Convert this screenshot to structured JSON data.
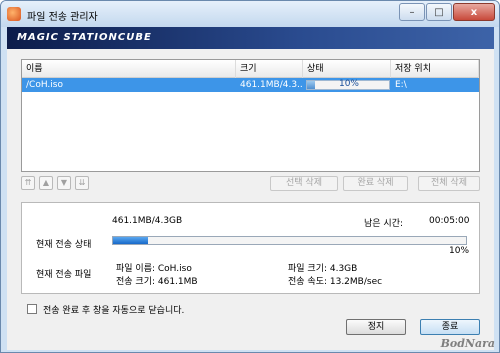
{
  "window": {
    "title": "파일 전송 관리자",
    "logo": "MAGIC STATIONCUBE",
    "minimize": "–",
    "maximize": "□",
    "close": "x"
  },
  "list": {
    "columns": [
      "이름",
      "크기",
      "상태",
      "저장 위치"
    ],
    "rows": [
      {
        "name": "/CoH.iso",
        "size": "461.1MB/4.3...",
        "status_percent": 10,
        "status_text": "10%",
        "location": "E:\\"
      }
    ]
  },
  "toolbar": {
    "move_top": "⇈",
    "move_up": "▲",
    "move_down": "▼",
    "move_bottom": "⇊",
    "delete_selected": "선택 삭제",
    "delete_completed": "완료 삭제",
    "delete_all": "전체 삭제"
  },
  "status": {
    "transferred": "461.1MB/4.3GB",
    "remaining_label": "남은 시간:",
    "remaining_time": "00:05:00",
    "current_status_label": "현재 전송 상태",
    "progress": 10,
    "progress_text": "10%",
    "current_file_label": "현재 전송 파일",
    "file_name": "파일 이름: CoH.iso",
    "file_size": "파일 크기: 4.3GB",
    "transfer_size": "전송 크기: 461.1MB",
    "transfer_speed": "전송 속도: 13.2MB/sec"
  },
  "footer": {
    "close_after_transfer": "전송 완료 후 창을 자동으로 닫습니다.",
    "stop_button": "정지",
    "exit_button": "종료"
  },
  "watermark": "BodNara"
}
